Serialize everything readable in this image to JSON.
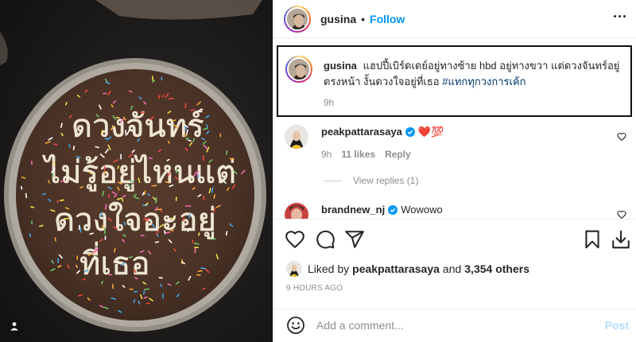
{
  "post": {
    "username": "gusina",
    "follow_label": "Follow",
    "separator": "•"
  },
  "caption": {
    "username": "gusina",
    "text": "แฮปปี้เบิร์ดเดย์อยู่ทางซ้าย hbd อยู่ทางขวา แต่ดวงจันทร์อยู่ตรงหน้า งั้นดวงใจอยู่ที่เธอ",
    "hashtag": "#แทกทุกวงการเค้ก",
    "time": "9h"
  },
  "comments": [
    {
      "username": "peakpattarasaya",
      "verified": true,
      "text": "❤️💯",
      "time": "9h",
      "likes": "11 likes",
      "reply_label": "Reply",
      "view_replies": "View replies (1)"
    },
    {
      "username": "brandnew_nj",
      "verified": true,
      "text": "Wowowo"
    }
  ],
  "likes": {
    "prefix": "Liked by",
    "user": "peakpattarasaya",
    "conjunction": "and",
    "others": "3,354 others"
  },
  "timestamp": "9 HOURS AGO",
  "comment_box": {
    "placeholder": "Add a comment...",
    "post_label": "Post"
  },
  "icons": {
    "heart": "heart-icon",
    "comment": "comment-icon",
    "share": "share-icon",
    "save": "bookmark-icon",
    "download": "download-icon",
    "emoji": "emoji-icon",
    "more": "more-icon",
    "user_tag": "user-tag-icon"
  },
  "colors": {
    "accent": "#0095f6",
    "hashtag": "#00376b",
    "verified": "#0095f6",
    "muted": "#8e8e8e",
    "cake": "#4a3327"
  }
}
